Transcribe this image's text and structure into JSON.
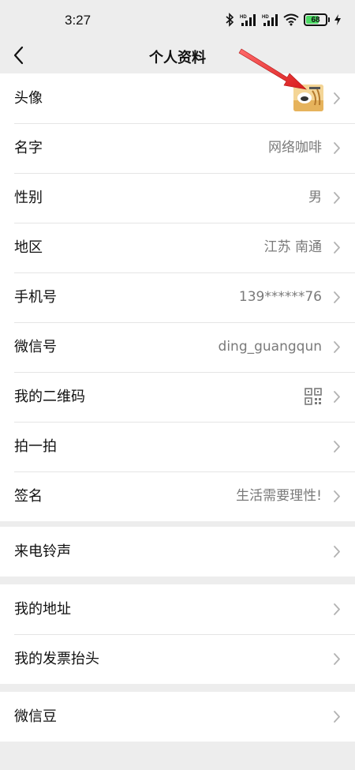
{
  "status": {
    "time": "3:27",
    "battery": "68",
    "battery_fraction": 0.68,
    "icons": [
      "bluetooth-icon",
      "signal-hd-icon",
      "signal-hd-icon",
      "wifi-icon",
      "battery-icon",
      "charging-icon"
    ]
  },
  "nav": {
    "title": "个人资料",
    "back_icon": "chevron-left-icon"
  },
  "groups": [
    {
      "rows": [
        {
          "label": "头像",
          "value": "",
          "type": "avatar"
        },
        {
          "label": "名字",
          "value": "网络咖啡"
        },
        {
          "label": "性别",
          "value": "男"
        },
        {
          "label": "地区",
          "value": "江苏 南通"
        },
        {
          "label": "手机号",
          "value": "139******76"
        },
        {
          "label": "微信号",
          "value": "ding_guangqun"
        },
        {
          "label": "我的二维码",
          "value": "",
          "type": "qr"
        },
        {
          "label": "拍一拍",
          "value": ""
        },
        {
          "label": "签名",
          "value": "生活需要理性!"
        }
      ]
    },
    {
      "rows": [
        {
          "label": "来电铃声",
          "value": ""
        }
      ]
    },
    {
      "rows": [
        {
          "label": "我的地址",
          "value": ""
        },
        {
          "label": "我的发票抬头",
          "value": ""
        }
      ]
    },
    {
      "rows": [
        {
          "label": "微信豆",
          "value": ""
        }
      ]
    }
  ],
  "colors": {
    "background": "#ededed",
    "row_bg": "#ffffff",
    "value_text": "#7a7a7a",
    "annotation_arrow": "#e8272b"
  }
}
